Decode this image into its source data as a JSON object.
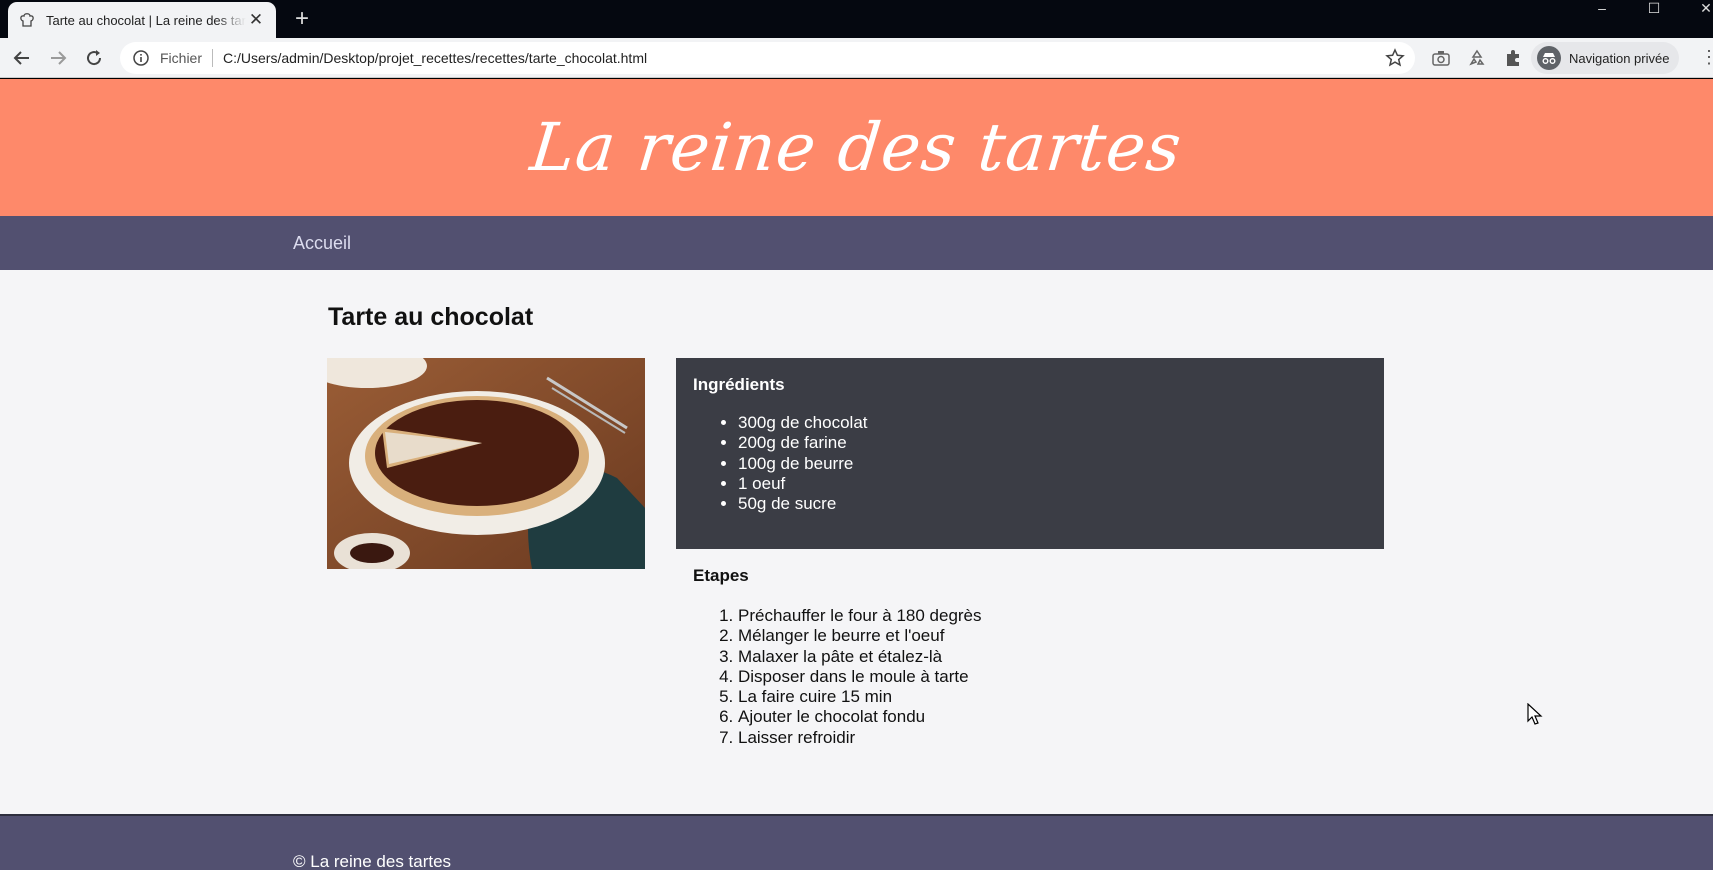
{
  "browser": {
    "tab_title": "Tarte au chocolat | La reine des tartes",
    "new_tab_symbol": "+",
    "close_symbol": "✕",
    "url_scheme": "Fichier",
    "url": "C:/Users/admin/Desktop/projet_recettes/recettes/tarte_chocolat.html",
    "profile_label": "Navigation privée",
    "window_controls": {
      "minimize": "–",
      "maximize": "☐",
      "close": "✕"
    }
  },
  "site": {
    "logo_text": "La reine des tartes",
    "nav": {
      "home": "Accueil"
    },
    "footer": "© La reine des tartes"
  },
  "recipe": {
    "title": "Tarte au chocolat",
    "ingredients_heading": "Ingrédients",
    "ingredients": [
      "300g de chocolat",
      "200g de farine",
      "100g de beurre",
      "1 oeuf",
      "50g de sucre"
    ],
    "steps_heading": "Etapes",
    "steps": [
      "Préchauffer le four à 180 degrès",
      "Mélanger le beurre et l'oeuf",
      "Malaxer la pâte et étalez-là",
      "Disposer dans le moule à tarte",
      "La faire cuire 15 min",
      "Ajouter le chocolat fondu",
      "Laisser refroidir"
    ]
  },
  "colors": {
    "header_bg": "#fe896a",
    "nav_bg": "#525070",
    "ingredients_bg": "#3b3d45",
    "page_bg": "#f5f5f7"
  }
}
